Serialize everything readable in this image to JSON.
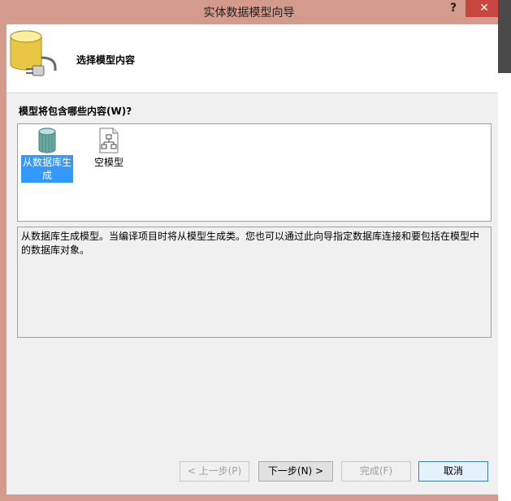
{
  "window": {
    "title": "实体数据模型向导",
    "help_label": "?",
    "close_label": "✕"
  },
  "header": {
    "icon": "database-plug-icon",
    "title": "选择模型内容"
  },
  "prompt": {
    "label": "模型将包含哪些内容(W)?"
  },
  "model_options": [
    {
      "label": "从数据库生成",
      "icon": "database-icon",
      "selected": true
    },
    {
      "label": "空模型",
      "icon": "empty-model-icon",
      "selected": false
    }
  ],
  "description": "从数据库生成模型。当编译项目时将从模型生成类。您也可以通过此向导指定数据库连接和要包括在模型中的数据库对象。",
  "buttons": {
    "back": "< 上一步(P)",
    "next": "下一步(N) >",
    "finish": "完成(F)",
    "cancel": "取消"
  },
  "colors": {
    "titlebar": "#d49b8c",
    "close": "#c7463e",
    "selection": "#3399ff",
    "dialog_bg": "#f0f0f0"
  }
}
